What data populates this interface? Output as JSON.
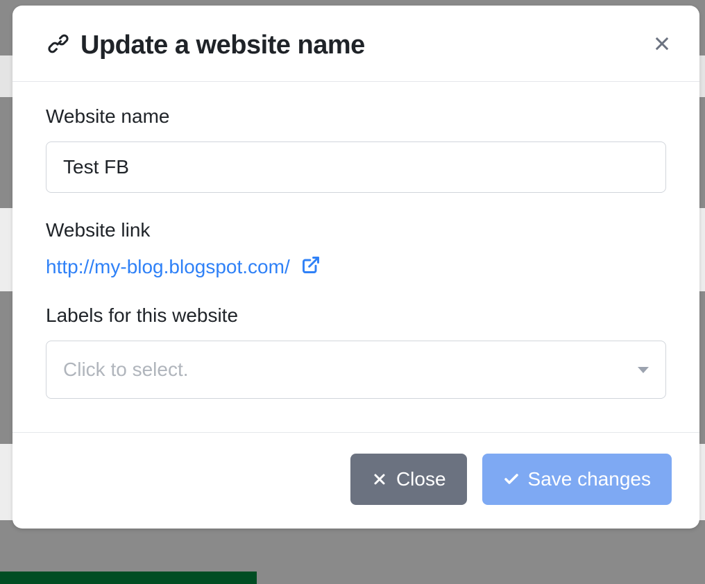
{
  "modal": {
    "title": "Update a website name",
    "fields": {
      "name_label": "Website name",
      "name_value": "Test FB",
      "link_label": "Website link",
      "link_value": "http://my-blog.blogspot.com/",
      "labels_label": "Labels for this website",
      "labels_placeholder": "Click to select."
    },
    "buttons": {
      "close": "Close",
      "save": "Save changes"
    }
  }
}
